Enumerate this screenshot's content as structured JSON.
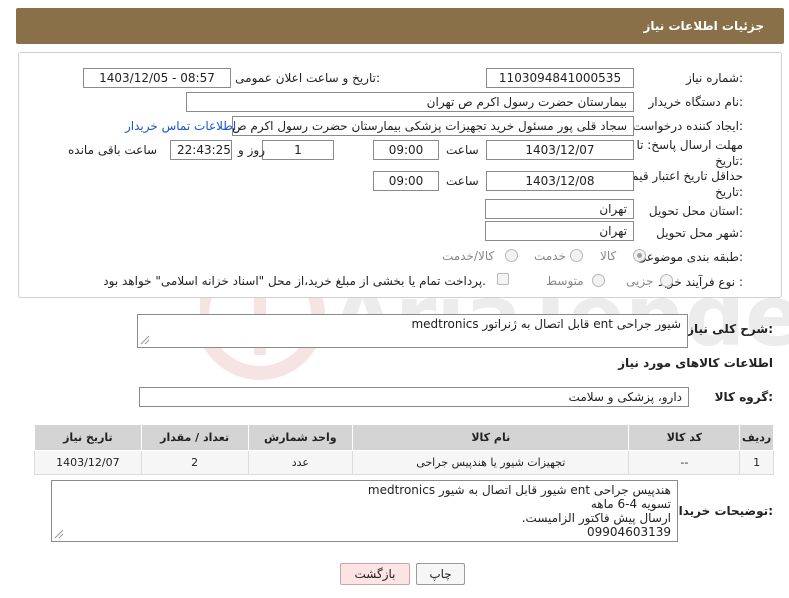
{
  "header": {
    "title": "جزئیات اطلاعات نیاز"
  },
  "form": {
    "need_number_label": "شماره نیاز:",
    "need_number": "1103094841000535",
    "announce_label": "تاریخ و ساعت اعلان عمومی:",
    "announce_value": "1403/12/05 - 08:57",
    "buyer_org_label": "نام دستگاه خریدار:",
    "buyer_org": "بیمارستان حضرت رسول اکرم ص  تهران",
    "creator_label": "ایجاد کننده درخواست:",
    "creator": "سجاد قلی پور مسئول خرید تجهیزات پزشکی  بیمارستان حضرت رسول اکرم ص",
    "contact_link": "اطلاعات تماس خریدار",
    "reply_deadline_label": "مهلت ارسال پاسخ: تا تاریخ:",
    "reply_date": "1403/12/07",
    "time_label": "ساعت",
    "reply_time": "09:00",
    "days_value": "1",
    "days_label": "روز و",
    "remaining_time": "22:43:25",
    "remaining_label": "ساعت باقی مانده",
    "price_deadline_label": "حداقل تاریخ اعتبار قیمت: تا تاریخ:",
    "price_date": "1403/12/08",
    "price_time": "09:00",
    "province_label": "استان محل تحویل:",
    "province": "تهران",
    "city_label": "شهر محل تحویل:",
    "city": "تهران",
    "category_label": "طبقه بندی موضوعی:",
    "category_options": [
      "کالا",
      "خدمت",
      "کالا/خدمت"
    ],
    "category_selected": "کالا",
    "process_label": "نوع فرآیند خرید :",
    "process_options": [
      "جزیی",
      "متوسط"
    ],
    "payment_note": "پرداخت تمام یا بخشی از مبلغ خرید،از محل \"اسناد خزانه اسلامی\" خواهد بود."
  },
  "summary": {
    "label": "شرح کلی نیاز:",
    "value": "شیور جراحی ent قابل اتصال به ژنراتور medtronics"
  },
  "goods_info": {
    "title": "اطلاعات کالاهای مورد نیاز",
    "group_label": "گروه کالا:",
    "group_value": "دارو، پزشکی و سلامت"
  },
  "table": {
    "headers": [
      "ردیف",
      "کد کالا",
      "نام کالا",
      "واحد شمارش",
      "تعداد / مقدار",
      "تاریخ نیاز"
    ],
    "rows": [
      [
        "1",
        "--",
        "تجهیزات شیور یا هندپیس جراحی",
        "عدد",
        "2",
        "1403/12/07"
      ]
    ]
  },
  "buyer_notes": {
    "label": "توضیحات خریدار:",
    "lines": [
      "هندپیس جراحی ent شیور قابل اتصال به شیور medtronics",
      "تسویه 4-6 ماهه",
      "ارسال پیش فاکتور الزامیست.",
      "09904603139"
    ]
  },
  "buttons": {
    "print": "چاپ",
    "back": "بازگشت"
  },
  "colors": {
    "header_bg": "#8a7048",
    "link": "#1a56c9",
    "table_header": "#d4d4d4"
  }
}
